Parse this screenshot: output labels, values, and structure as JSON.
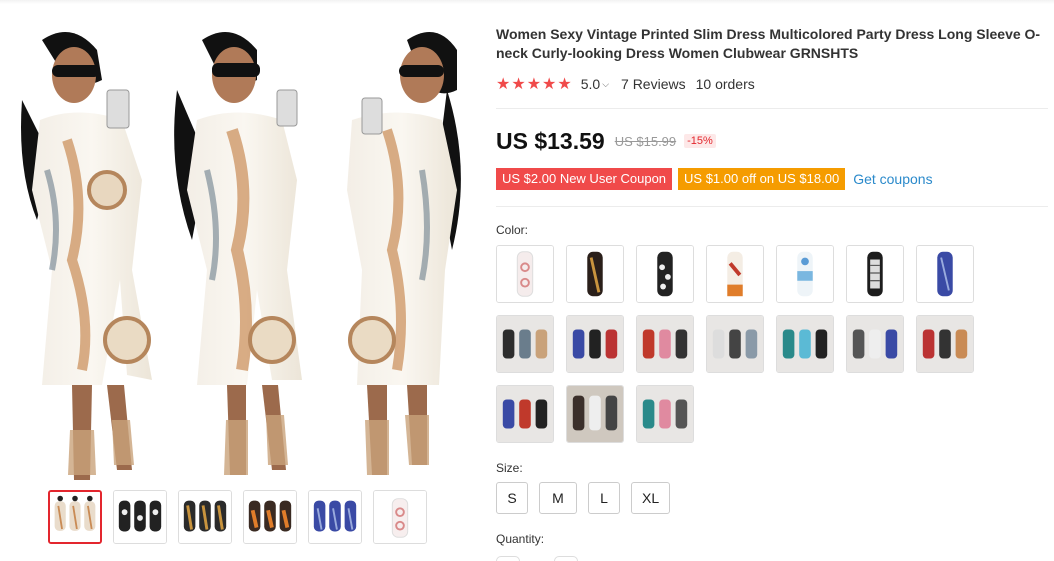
{
  "product": {
    "title": "Women Sexy Vintage Printed Slim Dress Multicolored Party Dress Long Sleeve O-neck Curly-looking Dress Women Clubwear GRNSHTS",
    "rating": {
      "stars": "★★★★★",
      "score": "5.0",
      "reviews": "7 Reviews",
      "orders": "10 orders"
    },
    "price": {
      "current": "US $13.59",
      "original": "US $15.99",
      "discount": "-15%"
    },
    "coupons": {
      "new_user": "US $2.00 New User Coupon",
      "store": "US $1.00 off on US $18.00",
      "link": "Get coupons"
    },
    "color": {
      "label": "Color:",
      "options": [
        "white-gold-print",
        "black-gold-print",
        "black-white-print",
        "white-orange-print",
        "blue-white-print",
        "black-white-pattern",
        "blue-print",
        "model-set-1",
        "model-set-2",
        "model-set-3",
        "model-set-4",
        "model-set-5",
        "model-set-6",
        "model-set-7",
        "model-set-8",
        "model-set-9",
        "model-set-10"
      ]
    },
    "size": {
      "label": "Size:",
      "options": [
        "S",
        "M",
        "L",
        "XL"
      ]
    },
    "quantity": {
      "label": "Quantity:"
    }
  },
  "gallery": {
    "thumbnails": [
      "white-gold",
      "black-white",
      "black-gold",
      "orange",
      "blue",
      "white-single"
    ],
    "selected": 0
  },
  "colors": {
    "accent_red": "#f04a4a",
    "coupon_orange": "#f59c00",
    "link_blue": "#2b8acb",
    "selected_border": "#e3262e"
  }
}
